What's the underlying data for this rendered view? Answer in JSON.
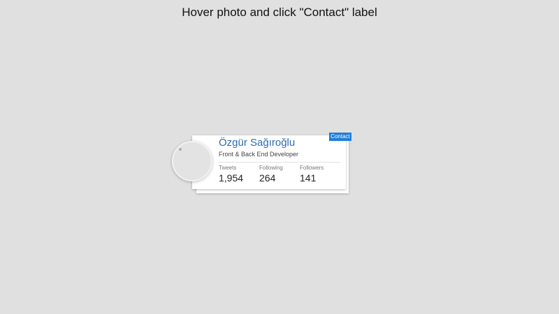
{
  "instruction": "Hover photo and click \"Contact\" label",
  "profile": {
    "name": "Özgür Sağıroğlu",
    "role": "Front & Back End Developer",
    "contact_label": "Contact",
    "photo_icon": "broken-image-icon",
    "stats": [
      {
        "label": "Tweets",
        "value": "1,954"
      },
      {
        "label": "Following",
        "value": "264"
      },
      {
        "label": "Followers",
        "value": "141"
      }
    ]
  },
  "colors": {
    "background": "#e0e0e0",
    "name": "#2b6cb3",
    "contact": "#1e7fd8"
  }
}
